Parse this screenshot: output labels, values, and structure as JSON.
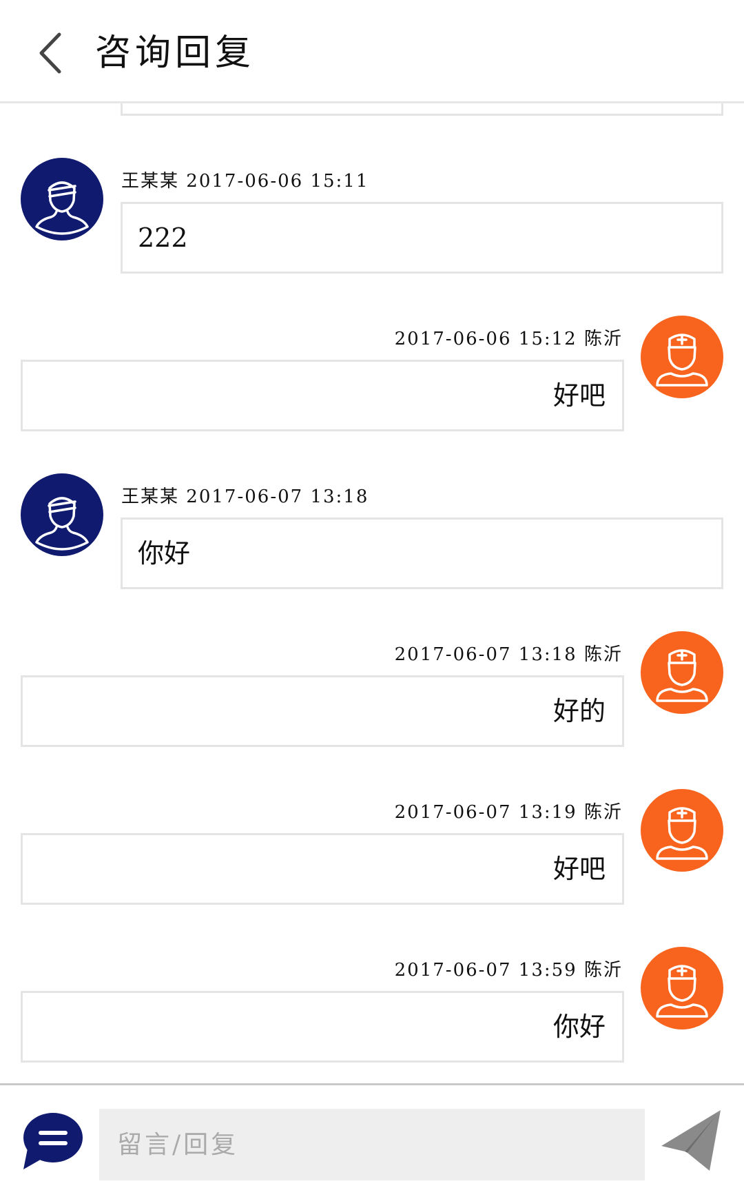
{
  "header": {
    "title": "咨询回复",
    "back_icon": "chevron-left-icon"
  },
  "messages": [
    {
      "role": "patient",
      "sender": "王某某",
      "time": "2017-06-06 15:11",
      "text": "222",
      "avatar_icon": "patient-avatar-icon"
    },
    {
      "role": "doctor",
      "sender": "陈沂",
      "time": "2017-06-06 15:12",
      "text": "好吧",
      "avatar_icon": "doctor-avatar-icon"
    },
    {
      "role": "patient",
      "sender": "王某某",
      "time": "2017-06-07 13:18",
      "text": "你好",
      "avatar_icon": "patient-avatar-icon"
    },
    {
      "role": "doctor",
      "sender": "陈沂",
      "time": "2017-06-07 13:18",
      "text": "好的",
      "avatar_icon": "doctor-avatar-icon"
    },
    {
      "role": "doctor",
      "sender": "陈沂",
      "time": "2017-06-07 13:19",
      "text": "好吧",
      "avatar_icon": "doctor-avatar-icon"
    },
    {
      "role": "doctor",
      "sender": "陈沂",
      "time": "2017-06-07 13:59",
      "text": "你好",
      "avatar_icon": "doctor-avatar-icon"
    }
  ],
  "input": {
    "placeholder": "留言/回复",
    "value": "",
    "left_icon": "message-bubble-icon",
    "send_icon": "paper-plane-icon"
  },
  "colors": {
    "patient_avatar": "#101a6e",
    "doctor_avatar": "#f8641e",
    "bubble_border": "#e4e4e4",
    "input_background": "#eeeeee"
  }
}
